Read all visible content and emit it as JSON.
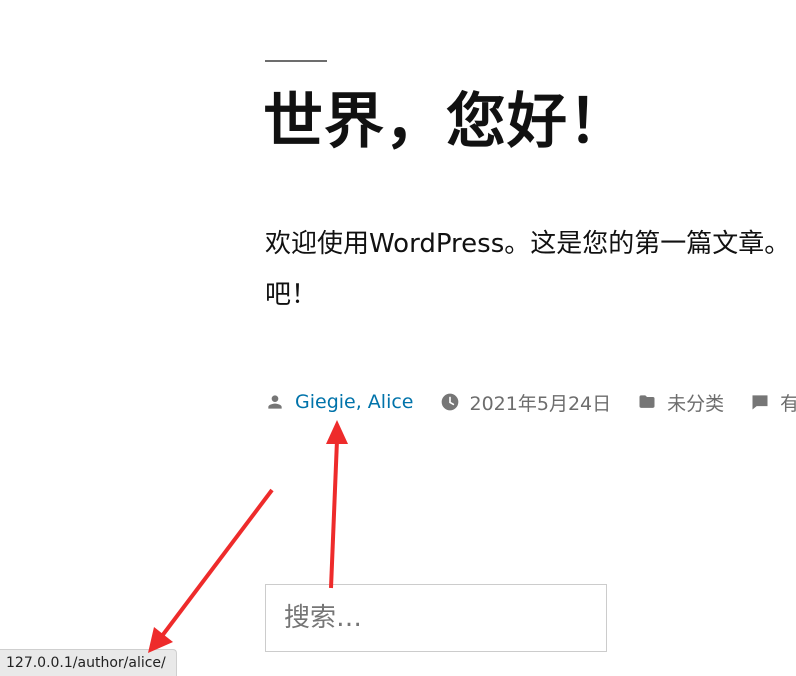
{
  "post": {
    "title": "世界，您好！",
    "excerpt_line1": "欢迎使用WordPress。这是您的第一篇文章。",
    "excerpt_line2": "吧！"
  },
  "meta": {
    "authors": "Giegie, Alice",
    "date": "2021年5月24日",
    "category": "未分类",
    "comments": "有"
  },
  "search": {
    "placeholder": "搜索…"
  },
  "status_bar": {
    "url": "127.0.0.1/author/alice/"
  },
  "icons": {
    "author": "person-icon",
    "date": "clock-icon",
    "category": "folder-icon",
    "comments": "comment-icon",
    "annotation": "red-arrow"
  },
  "colors": {
    "link": "#0073aa",
    "meta": "#6d6d6d",
    "arrow": "#ee2b2b"
  }
}
